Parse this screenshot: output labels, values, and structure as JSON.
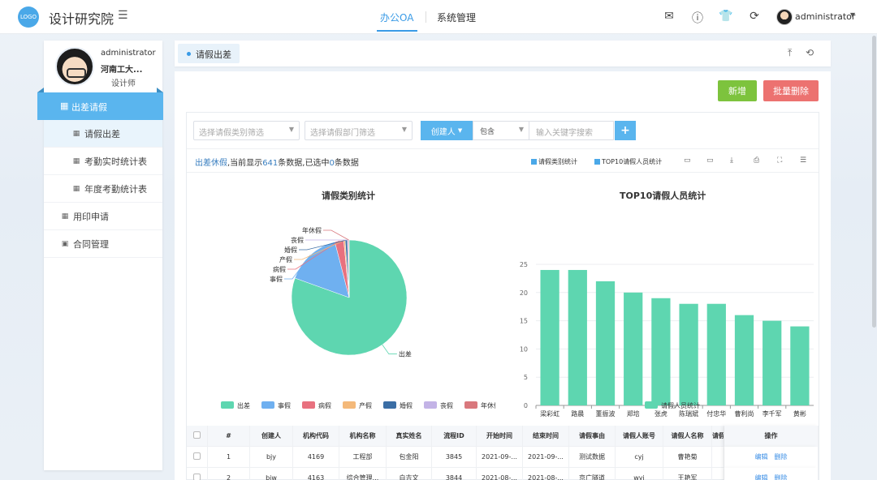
{
  "header": {
    "logo_text": "LOGO",
    "system_title": "设计研究院",
    "menu_icon": "list-icon",
    "nav_tabs": [
      {
        "label": "办公OA",
        "active": true
      },
      {
        "label": "系统管理",
        "active": false
      }
    ],
    "icons": [
      "mail-icon",
      "help-icon",
      "shirt-icon",
      "refresh-icon"
    ],
    "username": "administrator"
  },
  "sidebar": {
    "profile": {
      "name": "administrator",
      "org": "河南工大...",
      "role": "设计师"
    },
    "items": [
      {
        "label": "出差请假",
        "level": "top",
        "active": true
      },
      {
        "label": "请假出差",
        "level": "sub",
        "selected": true
      },
      {
        "label": "考勤实时统计表",
        "level": "sub"
      },
      {
        "label": "年度考勤统计表",
        "level": "sub"
      },
      {
        "label": "用印申请",
        "level": "top"
      },
      {
        "label": "合同管理",
        "level": "top"
      }
    ]
  },
  "tabs": [
    {
      "label": "请假出差",
      "active": true
    }
  ],
  "toolbar": {
    "add_label": "新增",
    "batch_delete_label": "批量删除"
  },
  "filters": {
    "type_placeholder": "选择请假类别筛选",
    "dept_placeholder": "选择请假部门筛选",
    "creator_label": "创建人",
    "operator": "包含",
    "keyword_placeholder": "输入关键字搜索",
    "add_filter": "+"
  },
  "summary": {
    "prefix": "出差休假",
    "mid1": ",当前显示",
    "count": "641",
    "mid2": "条数据,已选中",
    "selected": "0",
    "suffix": "条数据"
  },
  "view_toggles": [
    "请假类别统计",
    "TOP10请假人员统计"
  ],
  "colors": {
    "accent": "#5ab5ee",
    "green_button": "#7dc33d",
    "red_button": "#ec7270",
    "bar": "#5ed6b0"
  },
  "chart_data": [
    {
      "type": "pie",
      "title": "请假类别统计",
      "slices": [
        {
          "label": "出差",
          "value": 80.5,
          "color": "#5ed6b0"
        },
        {
          "label": "事假",
          "value": 15.5,
          "color": "#6fb0f0"
        },
        {
          "label": "病假",
          "value": 2.5,
          "color": "#e8717f"
        },
        {
          "label": "产假",
          "value": 0.4,
          "color": "#f4b97a"
        },
        {
          "label": "婚假",
          "value": 0.6,
          "color": "#3b6ea5"
        },
        {
          "label": "丧假",
          "value": 0.3,
          "color": "#c3b3e6"
        },
        {
          "label": "年休假",
          "value": 0.2,
          "color": "#d9787d"
        }
      ],
      "legend": [
        "出差",
        "事假",
        "病假",
        "产假",
        "婚假",
        "丧假",
        "年休假"
      ],
      "legend_position": "bottom"
    },
    {
      "type": "bar",
      "title": "TOP10请假人员统计",
      "categories": [
        "梁彩虹",
        "路晨",
        "董振波",
        "郑培",
        "张虎",
        "陈瑞斌",
        "付忠华",
        "曹利尚",
        "李千军",
        "黄彬"
      ],
      "series": [
        {
          "name": "请假人员统计",
          "values": [
            24,
            24,
            22,
            20,
            19,
            18,
            18,
            16,
            15,
            14
          ]
        }
      ],
      "ylim": [
        0,
        25
      ],
      "yticks": [
        0,
        5,
        10,
        15,
        20,
        25
      ],
      "grid": true,
      "legend_position": "bottom"
    }
  ],
  "table": {
    "headers": [
      "#",
      "创建人",
      "机构代码",
      "机构名称",
      "真实姓名",
      "流程ID",
      "开始时间",
      "结束时间",
      "请假事由",
      "请假人账号",
      "请假人名称",
      "请假",
      "操作"
    ],
    "rows": [
      [
        "1",
        "bjy",
        "4169",
        "工程部",
        "包金阳",
        "3845",
        "2021-09-...",
        "2021-09-...",
        "测试数据",
        "cyj",
        "曹艳菊",
        ""
      ],
      [
        "2",
        "bjw",
        "4163",
        "综合管理...",
        "白吉文",
        "3844",
        "2021-08-...",
        "2021-08-...",
        "京广隧道",
        "wyj",
        "王艳军",
        ""
      ]
    ],
    "edit_label": "编辑",
    "delete_label": "删除"
  }
}
